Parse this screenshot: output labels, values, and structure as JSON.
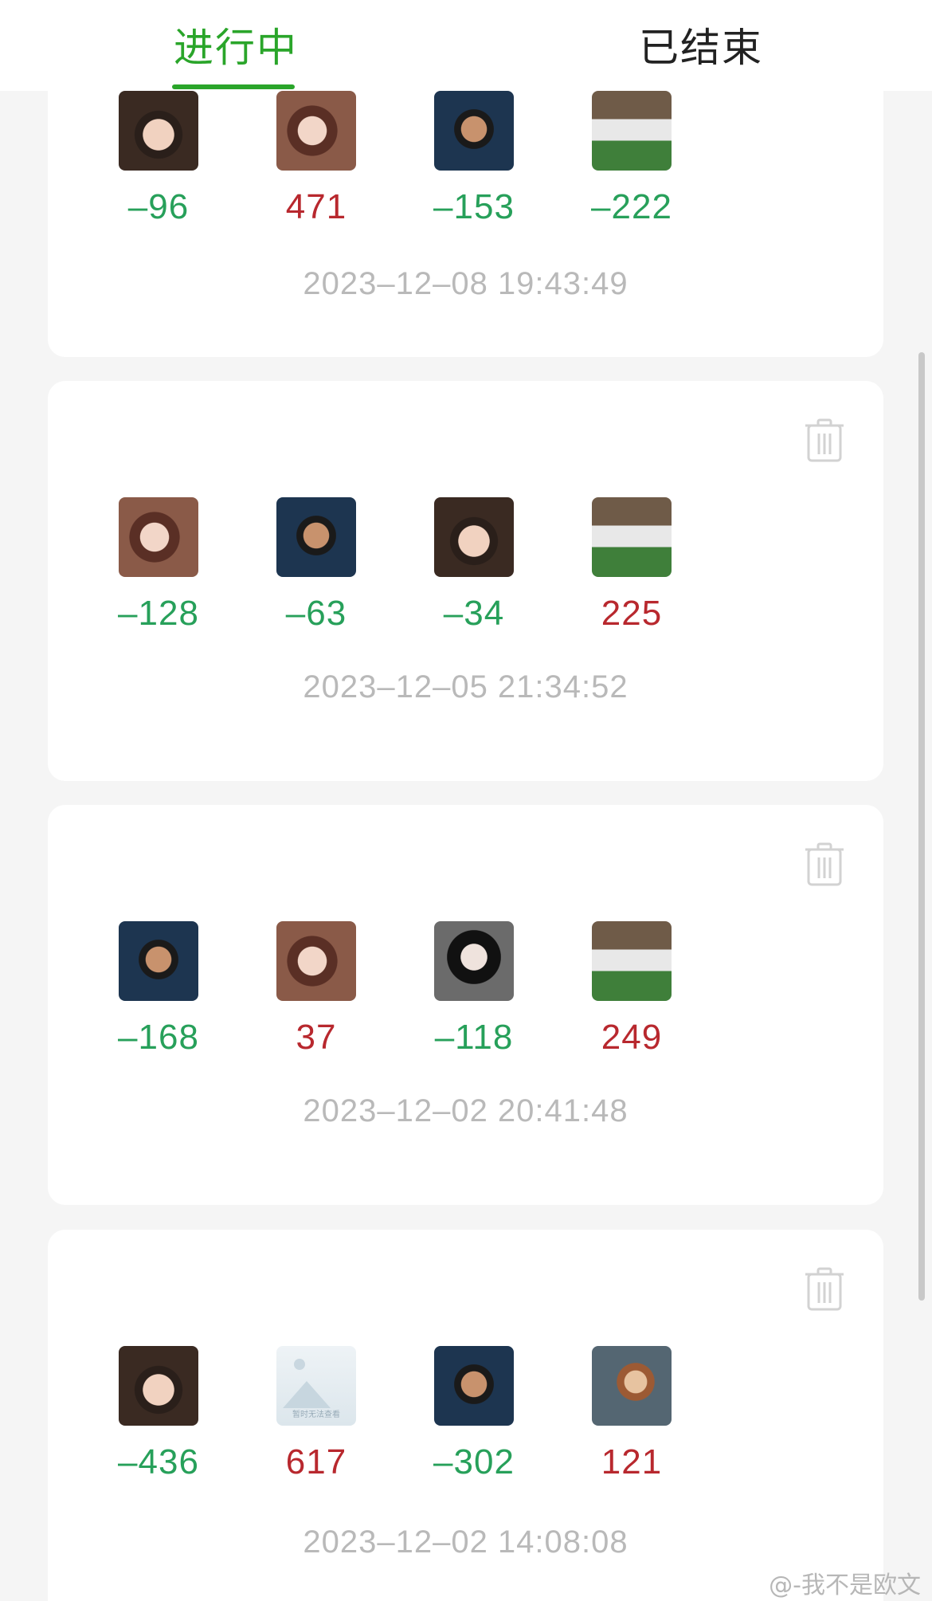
{
  "tabs": [
    {
      "label": "进行中",
      "active": true
    },
    {
      "label": "已结束",
      "active": false
    }
  ],
  "colors": {
    "accent": "#2aa52a",
    "negative_score": "#27a05a",
    "positive_score": "#b8282e",
    "timestamp": "#b9b9b9"
  },
  "games": [
    {
      "players": [
        {
          "avatar": "kid-photo",
          "score": "–96"
        },
        {
          "avatar": "girl-photo",
          "score": "471"
        },
        {
          "avatar": "anime-man",
          "score": "–153"
        },
        {
          "avatar": "girl-outdoor",
          "score": "–222"
        }
      ],
      "time": "2023–12–08 19:43:49"
    },
    {
      "players": [
        {
          "avatar": "girl-photo",
          "score": "–128"
        },
        {
          "avatar": "anime-man",
          "score": "–63"
        },
        {
          "avatar": "kid-photo",
          "score": "–34"
        },
        {
          "avatar": "girl-outdoor",
          "score": "225"
        }
      ],
      "time": "2023–12–05 21:34:52",
      "delete_icon": "trash-icon"
    },
    {
      "players": [
        {
          "avatar": "anime-man",
          "score": "–168"
        },
        {
          "avatar": "girl-photo",
          "score": "37"
        },
        {
          "avatar": "girl-dark-hair",
          "score": "–118"
        },
        {
          "avatar": "girl-outdoor",
          "score": "249"
        }
      ],
      "time": "2023–12–02 20:41:48",
      "delete_icon": "trash-icon"
    },
    {
      "players": [
        {
          "avatar": "kid-photo",
          "score": "–436"
        },
        {
          "avatar": "image-placeholder",
          "score": "617",
          "placeholder_text": "暂时无法查看"
        },
        {
          "avatar": "anime-man",
          "score": "–302"
        },
        {
          "avatar": "anime-girl",
          "score": "121"
        }
      ],
      "time": "2023–12–02 14:08:08",
      "delete_icon": "trash-icon"
    }
  ],
  "watermark": "@-我不是欧文"
}
